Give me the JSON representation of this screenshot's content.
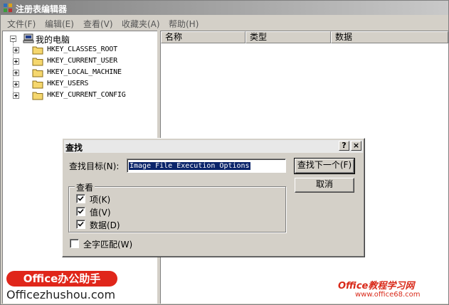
{
  "window": {
    "title": "注册表编辑器"
  },
  "menu": [
    {
      "label": "文件(F)"
    },
    {
      "label": "编辑(E)"
    },
    {
      "label": "查看(V)"
    },
    {
      "label": "收藏夹(A)"
    },
    {
      "label": "帮助(H)"
    }
  ],
  "tree": {
    "root_label": "我的电脑",
    "items": [
      {
        "label": "HKEY_CLASSES_ROOT"
      },
      {
        "label": "HKEY_CURRENT_USER"
      },
      {
        "label": "HKEY_LOCAL_MACHINE"
      },
      {
        "label": "HKEY_USERS"
      },
      {
        "label": "HKEY_CURRENT_CONFIG"
      }
    ]
  },
  "list": {
    "columns": [
      "名称",
      "类型",
      "数据"
    ]
  },
  "find_dialog": {
    "title": "查找",
    "help_button": "?",
    "close_button": "×",
    "find_what_label": "查找目标(N):",
    "find_what_value": "Image File Execution Options",
    "find_next_label": "查找下一个(F)",
    "cancel_label": "取消",
    "look_at_label": "查看",
    "options": [
      {
        "label": "项(K)",
        "checked": true
      },
      {
        "label": "值(V)",
        "checked": true
      },
      {
        "label": "数据(D)",
        "checked": true
      }
    ],
    "match_whole_label": "全字匹配(W)",
    "match_whole_checked": false
  },
  "watermarks": {
    "badge": "Office办公助手",
    "site": "Officezhushou.com",
    "right_brand": "Office教程学习网",
    "right_url": "www.office68.com"
  },
  "colors": {
    "selection": "#0a246a",
    "window_face": "#d4d0c8",
    "watermark_red": "#e0261a"
  }
}
